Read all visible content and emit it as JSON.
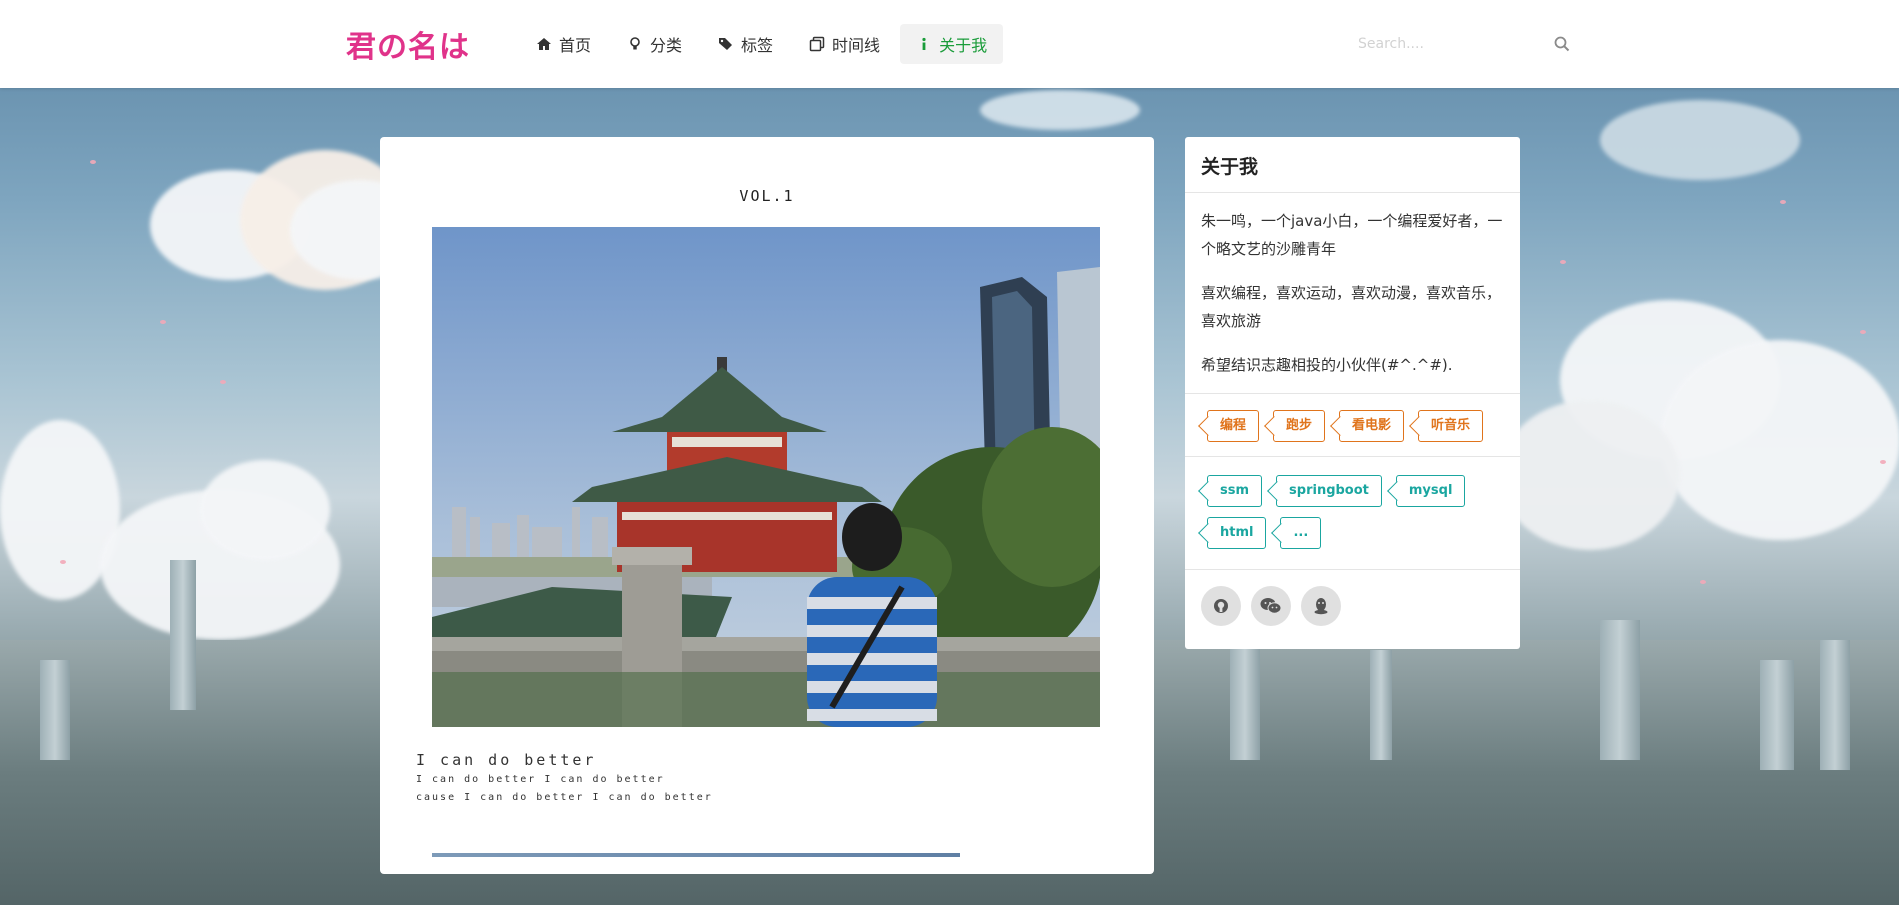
{
  "header": {
    "logo": "君の名は",
    "nav": [
      {
        "label": "首页",
        "icon": "home-icon"
      },
      {
        "label": "分类",
        "icon": "lightbulb-icon"
      },
      {
        "label": "标签",
        "icon": "tags-icon"
      },
      {
        "label": "时间线",
        "icon": "clone-icon"
      },
      {
        "label": "关于我",
        "icon": "info-icon",
        "active": true
      }
    ],
    "search": {
      "placeholder": "Search....",
      "icon": "search-icon"
    }
  },
  "article": {
    "vol": "VOL.1",
    "photo_alt": "",
    "line1": "I can do better",
    "line2": "I can do better I can do better",
    "line3": "cause I can do better I can do better",
    "progress": 0.79
  },
  "about": {
    "title": "关于我",
    "paragraphs": [
      "朱一鸣，一个java小白，一个编程爱好者，一个略文艺的沙雕青年",
      "喜欢编程，喜欢运动，喜欢动漫，喜欢音乐，喜欢旅游",
      "希望结识志趣相投的小伙伴(#^.^#)."
    ],
    "hobby_tags": [
      "编程",
      "跑步",
      "看电影",
      "听音乐"
    ],
    "tech_tags": [
      "ssm",
      "springboot",
      "mysql",
      "html",
      "..."
    ],
    "social": [
      {
        "icon": "github-icon"
      },
      {
        "icon": "wechat-icon"
      },
      {
        "icon": "qq-icon"
      }
    ]
  },
  "colors": {
    "logo": "#e0338a",
    "active_nav": "#1a9c3a",
    "hobby_tag": "#e0741c",
    "tech_tag": "#1aa6a0"
  }
}
